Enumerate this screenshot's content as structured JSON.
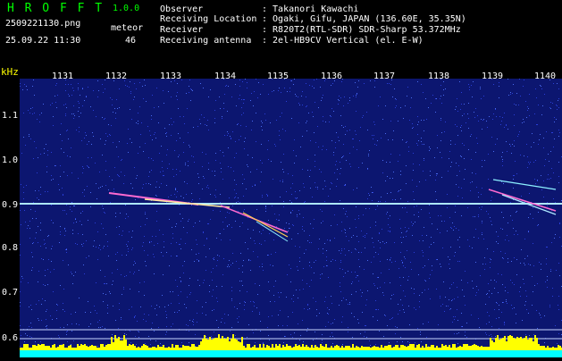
{
  "header": {
    "app_title": "H R O F F T",
    "version": "1.0.0",
    "filename": "2509221130.png",
    "meteor_label": "meteor",
    "datetime": "25.09.22 11:30",
    "meteor_count": "46",
    "info": [
      {
        "label": "Observer",
        "value": ": Takanori Kawachi"
      },
      {
        "label": "Receiving Location",
        "value": ": Ogaki, Gifu, JAPAN (136.60E, 35.35N)"
      },
      {
        "label": "Receiver",
        "value": ": R820T2(RTL-SDR) SDR-Sharp 53.372MHz"
      },
      {
        "label": "Receiving antenna",
        "value": ": 2el-HB9CV Vertical (el. E-W)"
      }
    ]
  },
  "axis": {
    "unit": "kHz",
    "time_ticks": [
      "1131",
      "1132",
      "1133",
      "1134",
      "1135",
      "1136",
      "1137",
      "1138",
      "1139",
      "1140"
    ],
    "freq_ticks": [
      "1.1",
      "1.0",
      "0.9",
      "0.8",
      "0.7",
      "0.6"
    ]
  },
  "colors": {
    "background": "#0c1670",
    "noise_a": "#2a3fd8",
    "noise_b": "#4a6cf0",
    "carrier": "#aee8ff",
    "echo": "#ff6ad0",
    "power_bar": "#ffff00",
    "baseline": "#00ffff"
  }
}
